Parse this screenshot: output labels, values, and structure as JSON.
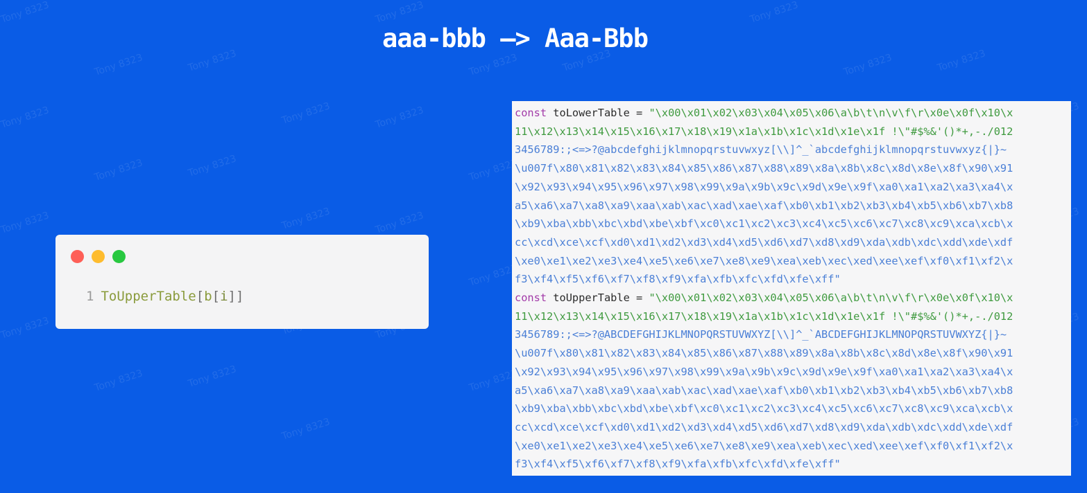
{
  "slide": {
    "title": "aaa-bbb —> Aaa-Bbb",
    "watermark_text": "Tony 8323"
  },
  "snippet_window": {
    "controls": [
      "close-dot",
      "minimize-dot",
      "maximize-dot"
    ],
    "line_number": "1",
    "tokens": {
      "identifier": "ToUpperTable",
      "open1": "[",
      "var": "b",
      "open2": "[",
      "index": "i",
      "close": "]]"
    }
  },
  "code_panel": {
    "lower": {
      "keyword": "const",
      "name": "toLowerTable",
      "assign": " = ",
      "lines": [
        "\"\\x00\\x01\\x02\\x03\\x04\\x05\\x06\\a\\b\\t\\n\\v\\f\\r\\x0e\\x0f\\x10\\x",
        "11\\x12\\x13\\x14\\x15\\x16\\x17\\x18\\x19\\x1a\\x1b\\x1c\\x1d\\x1e\\x1f !\\\"#$%&'()*+,-./012",
        "3456789:;<=>?@abcdefghijklmnopqrstuvwxyz[\\\\]^_`abcdefghijklmnopqrstuvwxyz{|}~",
        "\\u007f\\x80\\x81\\x82\\x83\\x84\\x85\\x86\\x87\\x88\\x89\\x8a\\x8b\\x8c\\x8d\\x8e\\x8f\\x90\\x91",
        "\\x92\\x93\\x94\\x95\\x96\\x97\\x98\\x99\\x9a\\x9b\\x9c\\x9d\\x9e\\x9f\\xa0\\xa1\\xa2\\xa3\\xa4\\x",
        "a5\\xa6\\xa7\\xa8\\xa9\\xaa\\xab\\xac\\xad\\xae\\xaf\\xb0\\xb1\\xb2\\xb3\\xb4\\xb5\\xb6\\xb7\\xb8",
        "\\xb9\\xba\\xbb\\xbc\\xbd\\xbe\\xbf\\xc0\\xc1\\xc2\\xc3\\xc4\\xc5\\xc6\\xc7\\xc8\\xc9\\xca\\xcb\\x",
        "cc\\xcd\\xce\\xcf\\xd0\\xd1\\xd2\\xd3\\xd4\\xd5\\xd6\\xd7\\xd8\\xd9\\xda\\xdb\\xdc\\xdd\\xde\\xdf",
        "\\xe0\\xe1\\xe2\\xe3\\xe4\\xe5\\xe6\\xe7\\xe8\\xe9\\xea\\xeb\\xec\\xed\\xee\\xef\\xf0\\xf1\\xf2\\x",
        "f3\\xf4\\xf5\\xf6\\xf7\\xf8\\xf9\\xfa\\xfb\\xfc\\xfd\\xfe\\xff\""
      ]
    },
    "upper": {
      "keyword": "const",
      "name": "toUpperTable",
      "assign": " = ",
      "lines": [
        "\"\\x00\\x01\\x02\\x03\\x04\\x05\\x06\\a\\b\\t\\n\\v\\f\\r\\x0e\\x0f\\x10\\x",
        "11\\x12\\x13\\x14\\x15\\x16\\x17\\x18\\x19\\x1a\\x1b\\x1c\\x1d\\x1e\\x1f !\\\"#$%&'()*+,-./012",
        "3456789:;<=>?@ABCDEFGHIJKLMNOPQRSTUVWXYZ[\\\\]^_`ABCDEFGHIJKLMNOPQRSTUVWXYZ{|}~",
        "\\u007f\\x80\\x81\\x82\\x83\\x84\\x85\\x86\\x87\\x88\\x89\\x8a\\x8b\\x8c\\x8d\\x8e\\x8f\\x90\\x91",
        "\\x92\\x93\\x94\\x95\\x96\\x97\\x98\\x99\\x9a\\x9b\\x9c\\x9d\\x9e\\x9f\\xa0\\xa1\\xa2\\xa3\\xa4\\x",
        "a5\\xa6\\xa7\\xa8\\xa9\\xaa\\xab\\xac\\xad\\xae\\xaf\\xb0\\xb1\\xb2\\xb3\\xb4\\xb5\\xb6\\xb7\\xb8",
        "\\xb9\\xba\\xbb\\xbc\\xbd\\xbe\\xbf\\xc0\\xc1\\xc2\\xc3\\xc4\\xc5\\xc6\\xc7\\xc8\\xc9\\xca\\xcb\\x",
        "cc\\xcd\\xce\\xcf\\xd0\\xd1\\xd2\\xd3\\xd4\\xd5\\xd6\\xd7\\xd8\\xd9\\xda\\xdb\\xdc\\xdd\\xde\\xdf",
        "\\xe0\\xe1\\xe2\\xe3\\xe4\\xe5\\xe6\\xe7\\xe8\\xe9\\xea\\xeb\\xec\\xed\\xee\\xef\\xf0\\xf1\\xf2\\x",
        "f3\\xf4\\xf5\\xf6\\xf7\\xf8\\xf9\\xfa\\xfb\\xfc\\xfd\\xfe\\xff\""
      ]
    }
  },
  "colors": {
    "background": "#0a5ce6",
    "keyword": "#a23aa8",
    "string_green": "#3f9a3f",
    "string_blue": "#4a7fd6"
  }
}
